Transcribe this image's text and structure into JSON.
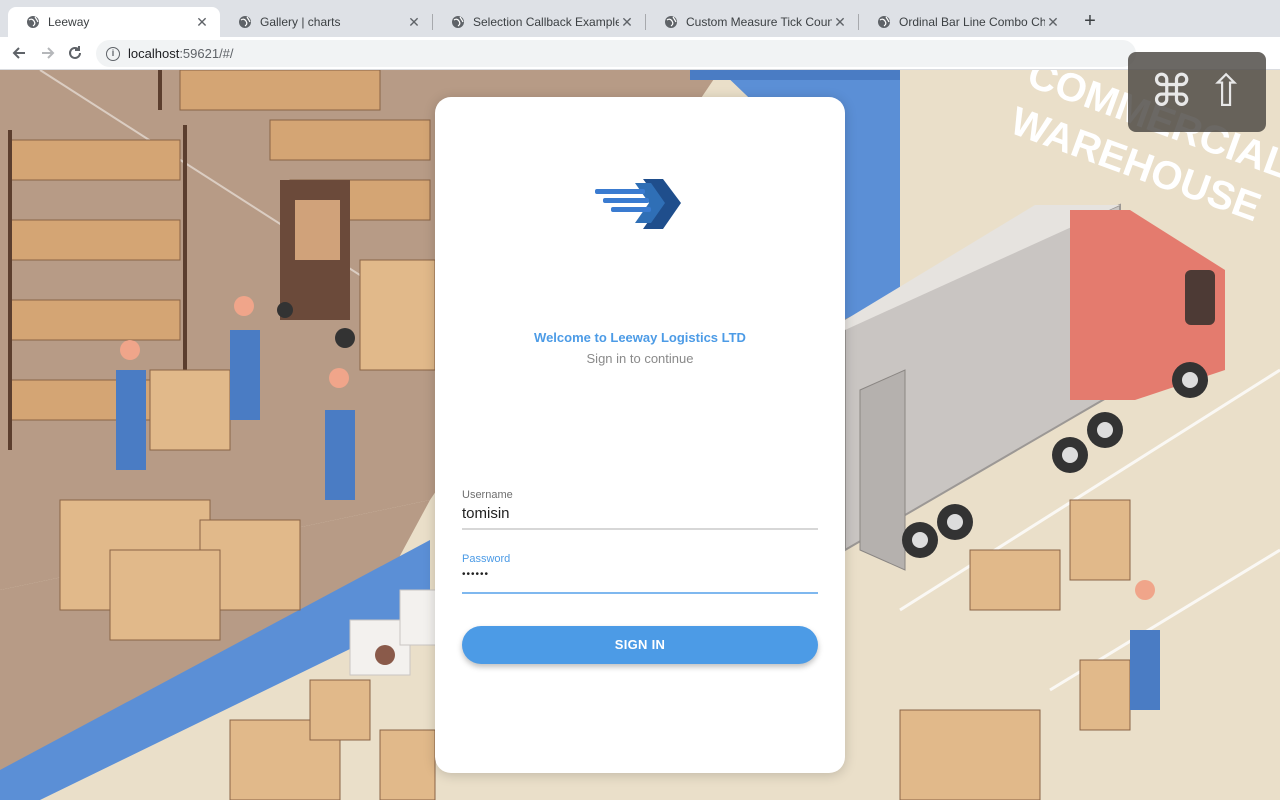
{
  "browser": {
    "tabs": [
      {
        "title": "Leeway",
        "active": true
      },
      {
        "title": "Gallery | charts",
        "active": false
      },
      {
        "title": "Selection Callback Example Int",
        "active": false
      },
      {
        "title": "Custom Measure Tick Count A",
        "active": false
      },
      {
        "title": "Ordinal Bar Line Combo Chart",
        "active": false
      }
    ],
    "new_tab_label": "+",
    "close_label": "✕",
    "url_host": "localhost",
    "url_rest": ":59621/#/"
  },
  "overlay": {
    "cmd_symbol": "⌘",
    "shift_symbol": "⇧"
  },
  "background": {
    "sign_text_line1": "COMMERCIAL",
    "sign_text_line2": "WAREHOUSE"
  },
  "login": {
    "welcome": "Welcome to Leeway Logistics LTD",
    "subtitle": "Sign in to continue",
    "username_label": "Username",
    "username_value": "tomisin",
    "password_label": "Password",
    "password_value": "••••••",
    "button_label": "SIGN IN"
  },
  "colors": {
    "accent": "#4c9be6",
    "floor": "#e9ddc6",
    "warehouse_floor": "#b89a85",
    "conveyor": "#5b8fd6",
    "truck_cab": "#e47b6e"
  }
}
